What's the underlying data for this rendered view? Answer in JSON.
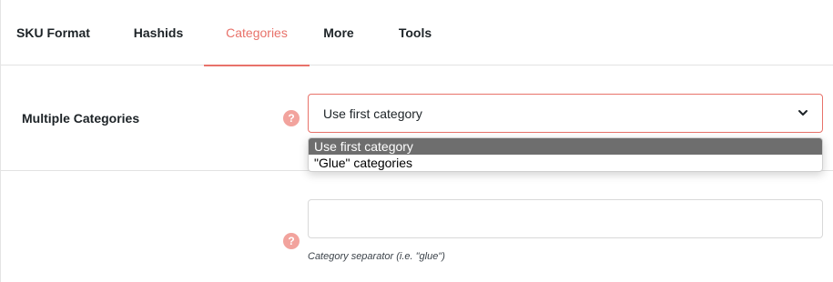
{
  "tabs": [
    {
      "label": "SKU Format",
      "active": false
    },
    {
      "label": "Hashids",
      "active": false
    },
    {
      "label": "Categories",
      "active": true
    },
    {
      "label": "More",
      "active": false
    },
    {
      "label": "Tools",
      "active": false
    }
  ],
  "colors": {
    "accent": "#e8726a",
    "help_icon": "#f2a39d",
    "selected_option_bg": "#6e6e6e"
  },
  "settings": {
    "multiple_categories": {
      "label": "Multiple Categories",
      "help_icon": "?",
      "selected_value": "Use first category",
      "options": [
        "Use first category",
        "\"Glue\" categories"
      ]
    },
    "category_separator": {
      "help_icon": "?",
      "value": "",
      "description": "Category separator (i.e. \"glue\")"
    }
  }
}
